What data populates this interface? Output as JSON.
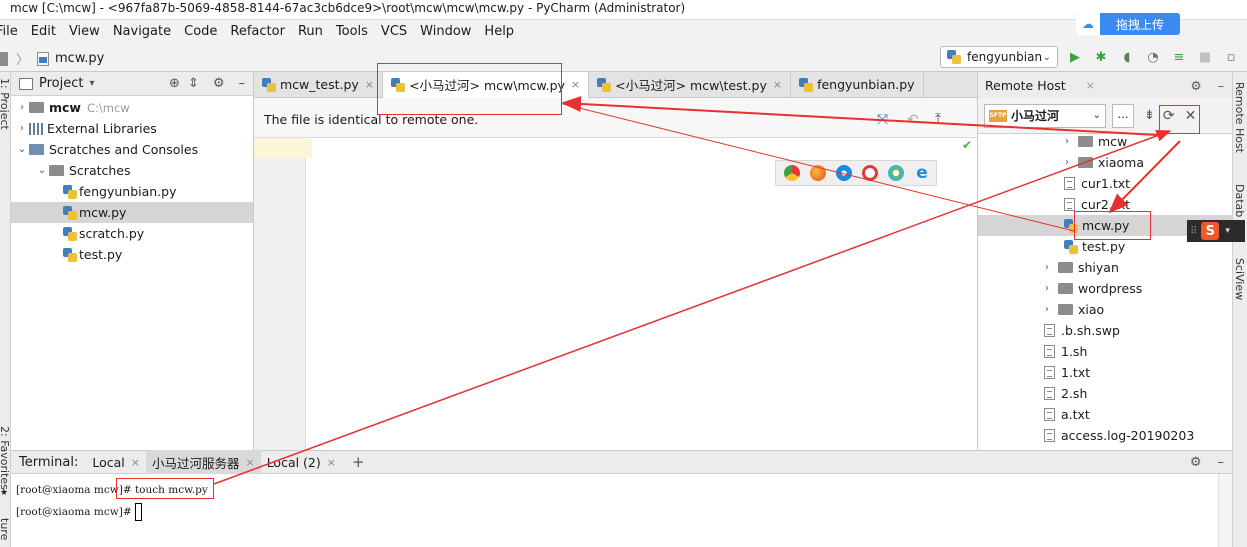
{
  "window": {
    "title": "mcw [C:\\mcw] - <967fa87b-5069-4858-8144-67ac3cb6dce9>\\root\\mcw\\mcw\\mcw.py - PyCharm (Administrator)",
    "upload_label": "拖拽上传"
  },
  "menu": [
    "File",
    "Edit",
    "View",
    "Navigate",
    "Code",
    "Refactor",
    "Run",
    "Tools",
    "VCS",
    "Window",
    "Help"
  ],
  "navbar": {
    "breadcrumb": "mcw.py",
    "run_config": "fengyunbian"
  },
  "left_strip": {
    "project_label": "1: Project",
    "favorites_label": "2: Favorites",
    "structure_label": "ture"
  },
  "right_strip": {
    "remote_host_label": "Remote Host",
    "database_label": "Datab",
    "sciview_label": "SciView"
  },
  "project_panel": {
    "title": "Project",
    "items": [
      {
        "label": "mcw",
        "extra": "C:\\mcw",
        "level": 0,
        "arrow": "›",
        "icon": "folder"
      },
      {
        "label": "External Libraries",
        "level": 0,
        "arrow": "›",
        "icon": "libs"
      },
      {
        "label": "Scratches and Consoles",
        "level": 0,
        "arrow": "⌄",
        "icon": "scratches"
      },
      {
        "label": "Scratches",
        "level": 1,
        "arrow": "⌄",
        "icon": "folder"
      },
      {
        "label": "fengyunbian.py",
        "level": 2,
        "icon": "py"
      },
      {
        "label": "mcw.py",
        "level": 2,
        "icon": "py",
        "selected": true
      },
      {
        "label": "scratch.py",
        "level": 2,
        "icon": "py"
      },
      {
        "label": "test.py",
        "level": 2,
        "icon": "py"
      }
    ]
  },
  "editor": {
    "tabs": [
      {
        "label": "mcw_test.py",
        "active": false
      },
      {
        "label": "<小马过河> mcw\\mcw.py",
        "active": true
      },
      {
        "label": "<小马过河> mcw\\test.py",
        "active": false
      },
      {
        "label": "fengyunbian.py",
        "active": false
      }
    ],
    "banner": "The file is identical to remote one."
  },
  "remote_host": {
    "title": "Remote Host",
    "server": "小马过河",
    "items": [
      {
        "label": "mcw",
        "type": "folder",
        "level": 1
      },
      {
        "label": "xiaoma",
        "type": "folder",
        "level": 1
      },
      {
        "label": "cur1.txt",
        "type": "txt",
        "level": 2
      },
      {
        "label": "cur2.txt",
        "type": "txt",
        "level": 2
      },
      {
        "label": "mcw.py",
        "type": "py",
        "level": 2,
        "selected": true
      },
      {
        "label": "test.py",
        "type": "py",
        "level": 2
      },
      {
        "label": "shiyan",
        "type": "folder",
        "level": 0
      },
      {
        "label": "wordpress",
        "type": "folder",
        "level": 0
      },
      {
        "label": "xiao",
        "type": "folder",
        "level": 0
      },
      {
        "label": ".b.sh.swp",
        "type": "txt",
        "level": 1
      },
      {
        "label": "1.sh",
        "type": "txt",
        "level": 1
      },
      {
        "label": "1.txt",
        "type": "txt",
        "level": 1
      },
      {
        "label": "2.sh",
        "type": "txt",
        "level": 1
      },
      {
        "label": "a.txt",
        "type": "txt",
        "level": 1
      },
      {
        "label": "access.log-20190203",
        "type": "txt",
        "level": 1
      }
    ]
  },
  "terminal": {
    "title": "Terminal:",
    "tabs": [
      {
        "label": "Local",
        "active": false
      },
      {
        "label": "小马过河服务器",
        "active": true
      },
      {
        "label": "Local (2)",
        "active": false
      }
    ],
    "add": "+",
    "lines": [
      "[root@xiaoma mcw]# touch mcw.py",
      "[root@xiaoma mcw]#"
    ]
  },
  "colors": {
    "annotation": "#e8302f",
    "run_green": "#3aa63a",
    "check_green": "#4caf50"
  }
}
